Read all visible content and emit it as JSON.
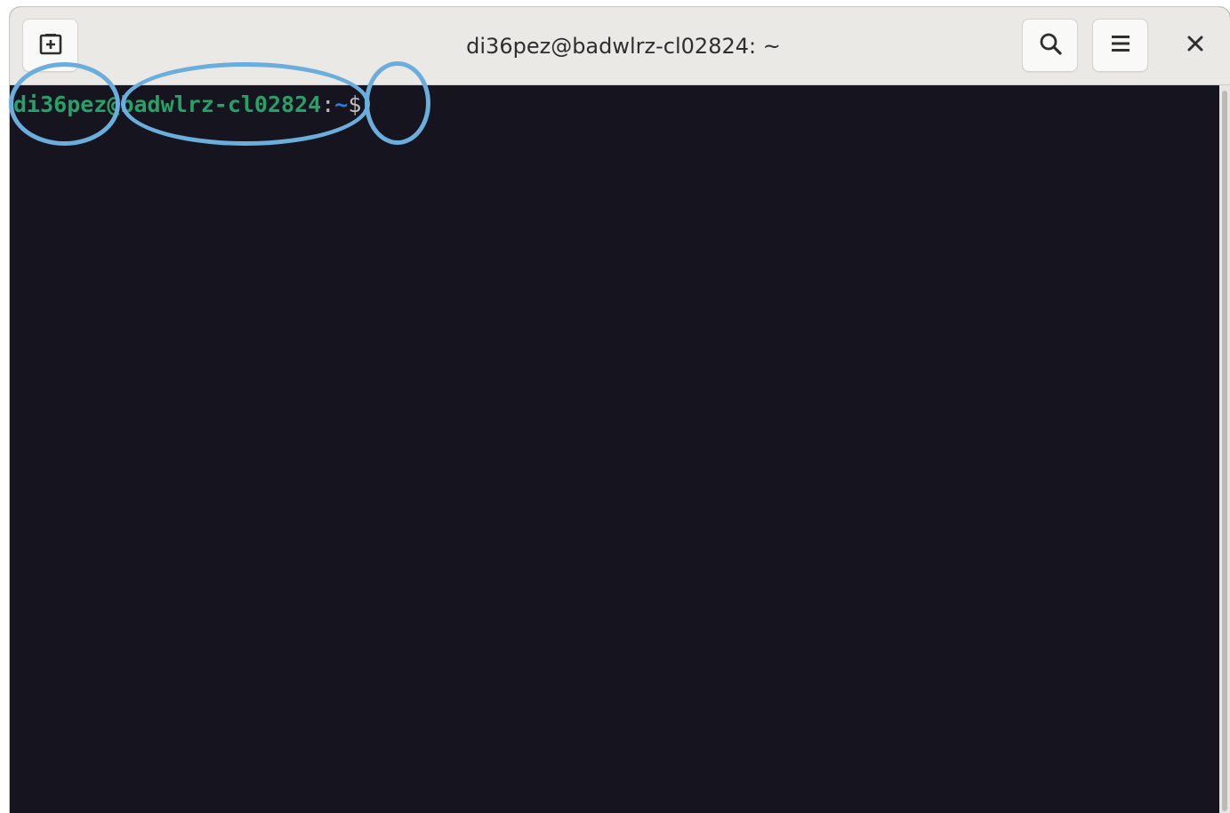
{
  "window": {
    "title": "di36pez@badwlrz-cl02824: ~"
  },
  "headerbar": {
    "new_tab_icon": "tab-new-icon",
    "search_icon": "search-icon",
    "menu_icon": "hamburger-menu-icon",
    "close_glyph": "✕"
  },
  "terminal": {
    "prompt": {
      "user": "di36pez",
      "at": "@",
      "host": "badwlrz-cl02824",
      "colon": ":",
      "dir": "~",
      "symbol": "$"
    }
  },
  "colors": {
    "prompt_user_host": "#26a269",
    "prompt_dir": "#2a7bde",
    "terminal_bg": "#16141f",
    "annotation_outline": "#6aaede"
  }
}
